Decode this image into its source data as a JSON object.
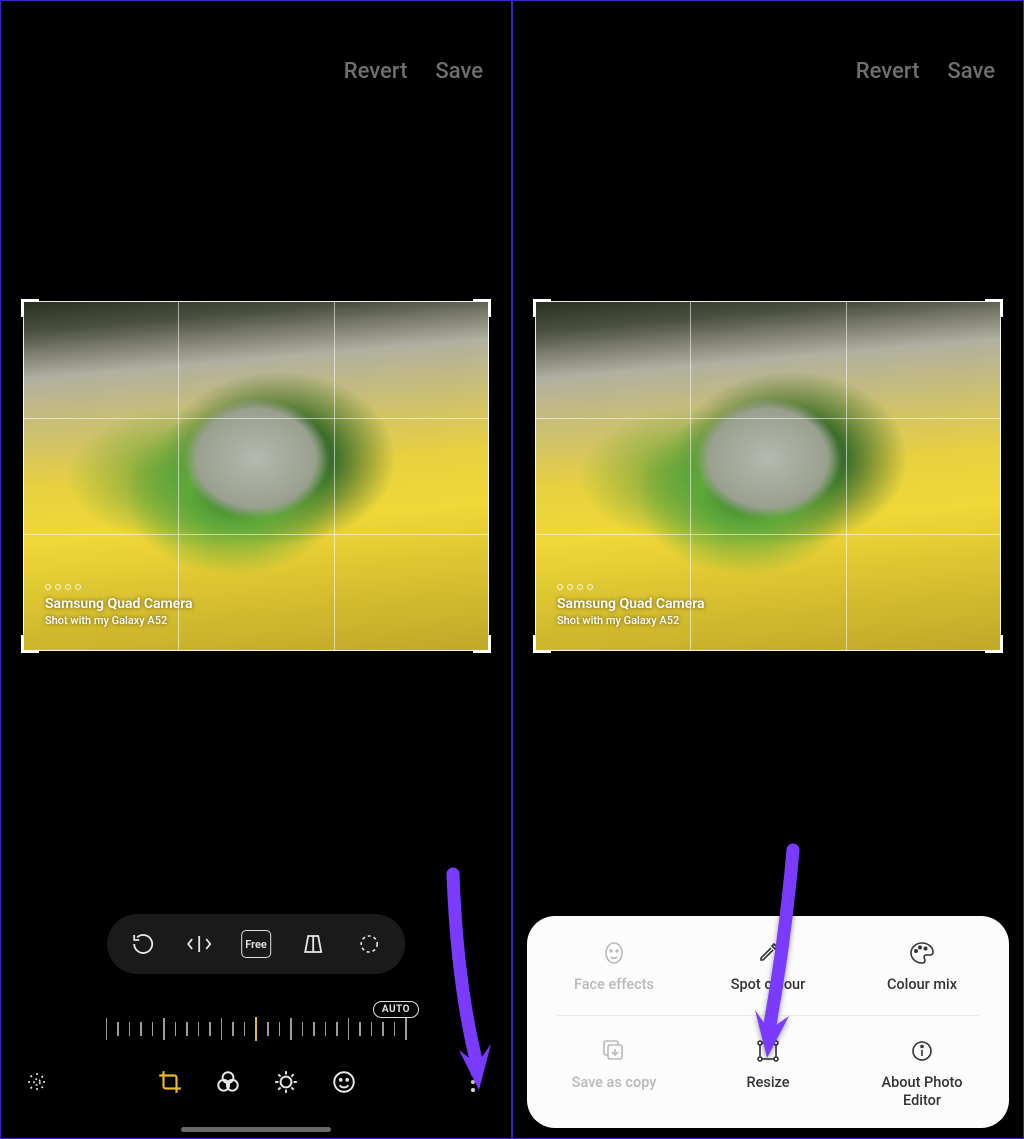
{
  "top_actions": {
    "revert": "Revert",
    "save": "Save"
  },
  "watermark": {
    "title": "Samsung Quad Camera",
    "subtitle": "Shot with my Galaxy A52"
  },
  "crop_tools": {
    "rotate": "rotate",
    "flip": "flip",
    "ratio": "Free",
    "perspective": "perspective",
    "lasso": "lasso"
  },
  "auto_label": "AUTO",
  "bottom_nav": {
    "magic": "auto-enhance",
    "crop": "crop",
    "filters": "filters",
    "adjust": "adjust",
    "stickers": "stickers",
    "more": "more"
  },
  "popup": {
    "row1": {
      "face_effects": "Face effects",
      "spot_colour": "Spot colour",
      "colour_mix": "Colour mix"
    },
    "row2": {
      "save_as_copy": "Save as copy",
      "resize": "Resize",
      "about": "About Photo Editor"
    }
  },
  "colors": {
    "accent": "#e8b928",
    "arrow": "#7b3bff"
  }
}
